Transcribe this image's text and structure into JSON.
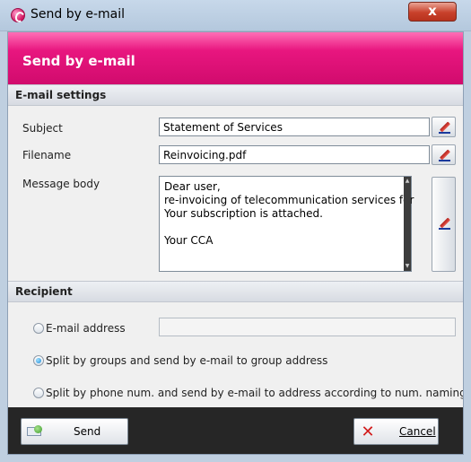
{
  "window": {
    "title": "Send by e-mail",
    "close_glyph": "x"
  },
  "banner": {
    "title": "Send by e-mail",
    "color": "#e8167f"
  },
  "email_settings": {
    "header": "E-mail settings",
    "subject_label": "Subject",
    "subject_value": "Statement of Services",
    "filename_label": "Filename",
    "filename_value": "Reinvoicing.pdf",
    "message_label": "Message body",
    "message_lines": [
      "Dear user,",
      "re-invoicing of telecommunication services for",
      "Your subscription is attached.",
      "",
      "Your CCA"
    ]
  },
  "recipient": {
    "header": "Recipient",
    "options": [
      {
        "label": "E-mail address",
        "selected": false
      },
      {
        "label": "Split by groups and send by e-mail to group address",
        "selected": true
      },
      {
        "label": "Split by phone num. and send by e-mail to address according to num. naming",
        "selected": false
      }
    ],
    "email_address_value": ""
  },
  "footer": {
    "send_label": "Send",
    "cancel_label": "Cancel"
  },
  "icons": [
    "app-icon",
    "close-icon",
    "pencil-icon",
    "mail-send-icon",
    "cancel-x-icon"
  ]
}
